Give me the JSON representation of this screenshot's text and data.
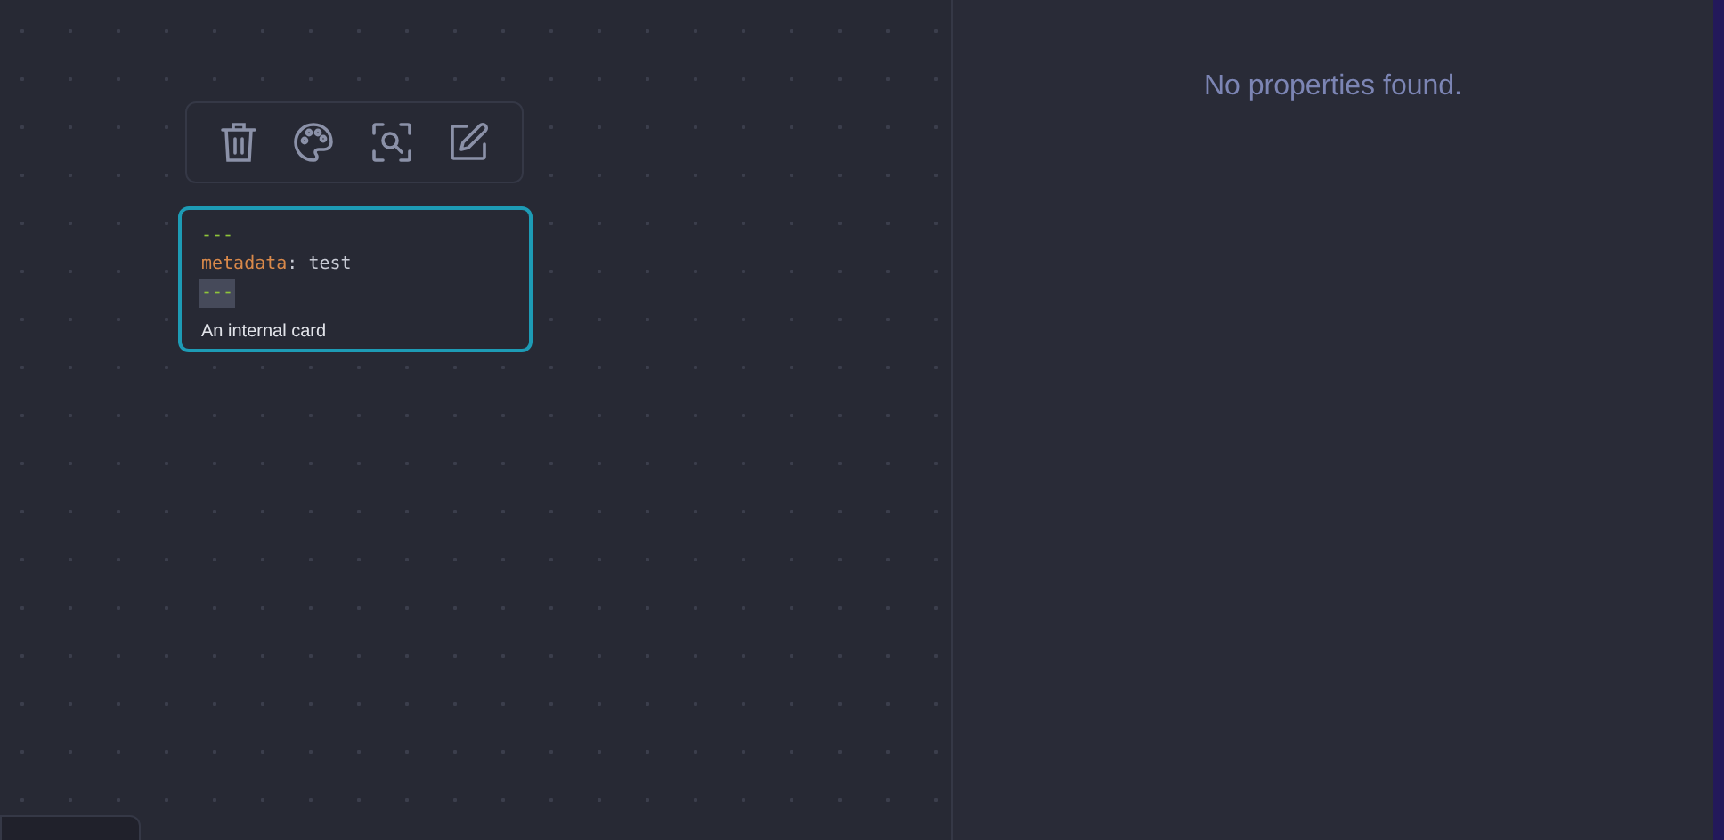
{
  "card": {
    "selected": true,
    "lines": [
      {
        "kind": "delimiter",
        "text": "---",
        "highlighted": false
      },
      {
        "kind": "property",
        "key": "metadata",
        "separator": ":",
        "value": "test"
      },
      {
        "kind": "delimiter",
        "text": "---",
        "highlighted": true
      }
    ],
    "body": "An internal card"
  },
  "properties_panel": {
    "empty_message": "No properties found."
  }
}
